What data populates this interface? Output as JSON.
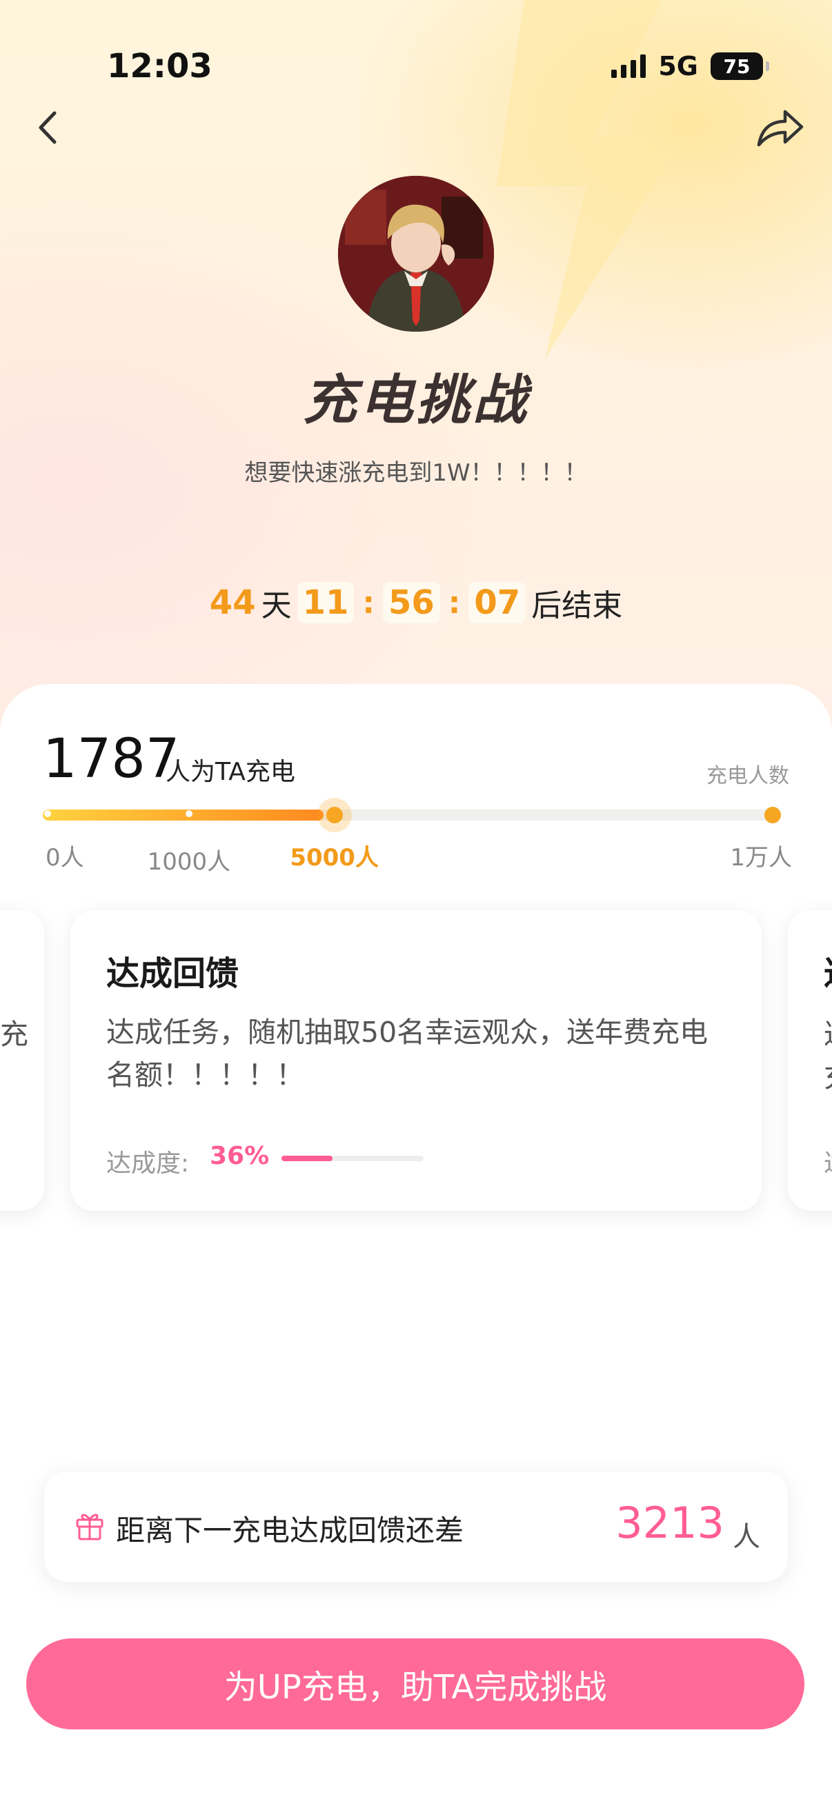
{
  "status_bar": {
    "time": "12:03",
    "network": "5G",
    "battery": "75"
  },
  "header": {
    "back_icon": "chevron-left-icon",
    "share_icon": "share-arrow-icon"
  },
  "challenge": {
    "title": "充电挑战",
    "subtitle": "想要快速涨充电到1W！！！！！",
    "countdown": {
      "days": "44",
      "days_unit": "天",
      "hours": "11",
      "minutes": "56",
      "seconds": "07",
      "suffix": "后结束",
      "separator": ":"
    }
  },
  "progress": {
    "count": "1787",
    "count_label": "人为TA充电",
    "right_label": "充电人数",
    "fill_fraction": 0.38,
    "milestones": [
      {
        "label": "0人",
        "fraction": 0.0
      },
      {
        "label": "1000人",
        "fraction": 0.198
      },
      {
        "label": "5000人",
        "fraction": 0.395,
        "active": true
      },
      {
        "label": "1万人",
        "fraction": 1.0
      }
    ]
  },
  "cards": {
    "main": {
      "title": "达成回馈",
      "description": "达成任务，随机抽取50名幸运观众，送年费充电名额！！！！！",
      "progress_label": "达成度:",
      "progress_value": "36%",
      "progress_fraction": 0.36
    },
    "left_peek": {
      "text": "充"
    },
    "right_peek": {
      "title": "达",
      "line1": "达",
      "line2": "充",
      "line3": "达"
    }
  },
  "tip": {
    "icon": "gift-icon",
    "text": "距离下一充电达成回馈还差",
    "number": "3213",
    "unit": "人"
  },
  "cta": {
    "label": "为UP充电，助TA完成挑战"
  },
  "colors": {
    "accent_orange": "#f39a1a",
    "accent_pink": "#ff5d93",
    "cta_pink": "#ff6a99"
  }
}
